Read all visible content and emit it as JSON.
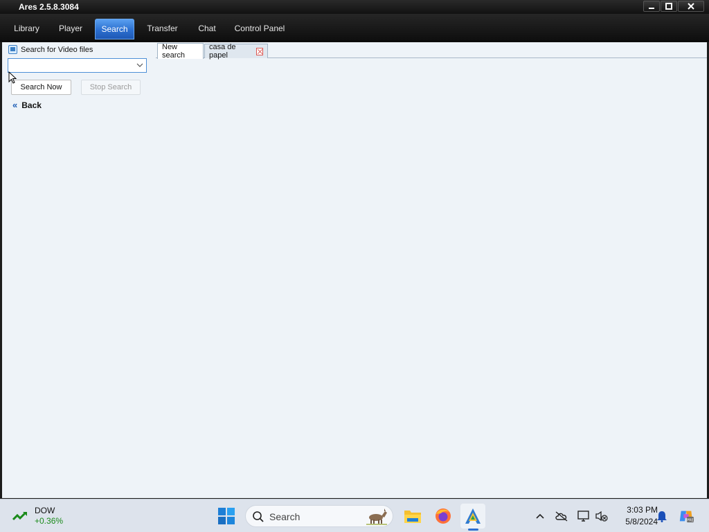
{
  "window": {
    "title": "Ares 2.5.8.3084"
  },
  "main_tabs": [
    {
      "label": "Library"
    },
    {
      "label": "Player"
    },
    {
      "label": "Search",
      "active": true
    },
    {
      "label": "Transfer"
    },
    {
      "label": "Chat"
    },
    {
      "label": "Control Panel"
    }
  ],
  "search_panel": {
    "type_label": "Search for Video files",
    "query_value": "",
    "search_now_label": "Search Now",
    "stop_search_label": "Stop Search",
    "back_label": "Back",
    "back_icon": "double-chevron-left-icon"
  },
  "result_tabs": [
    {
      "label": "New search",
      "active": true
    },
    {
      "label": "casa de papel",
      "closable": true
    }
  ],
  "taskbar": {
    "widget": {
      "name": "DOW",
      "change": "+0.36%"
    },
    "search_label": "Search",
    "clock": {
      "time": "3:03 PM",
      "date": "5/8/2024"
    }
  },
  "colors": {
    "active_tab": "#2b6fd0",
    "content_bg": "#eef3f8",
    "stock_up": "#1a8a1a",
    "close_red": "#d9534f"
  }
}
